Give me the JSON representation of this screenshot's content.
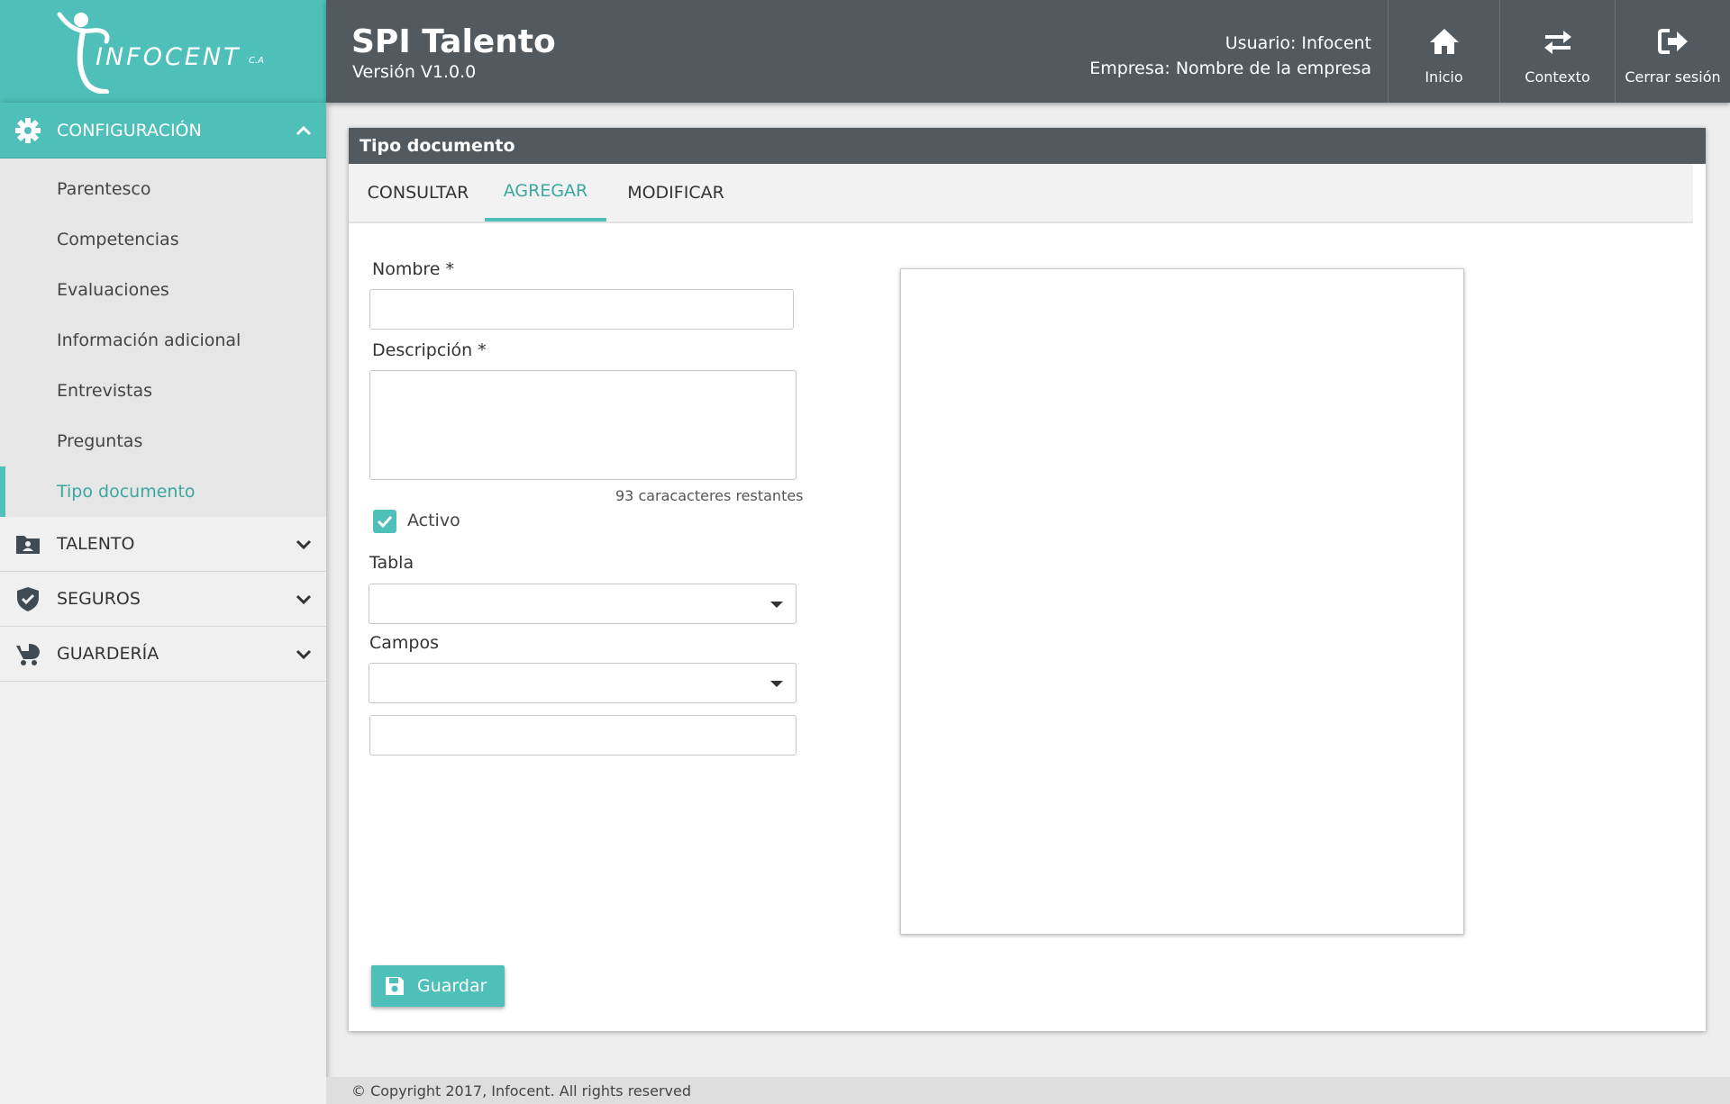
{
  "brand": {
    "logo_text": "INFOCENT",
    "logo_suffix": "C.A"
  },
  "header": {
    "app_title": "SPI Talento",
    "version": "Versión  V1.0.0",
    "user_line": "Usuario: Infocent",
    "company_line": "Empresa: Nombre de la empresa",
    "buttons": [
      {
        "label": "Inicio",
        "icon": "home-icon"
      },
      {
        "label": "Contexto",
        "icon": "swap-arrows-icon"
      },
      {
        "label": "Cerrar sesión",
        "icon": "sign-out-icon"
      }
    ]
  },
  "sidebar": {
    "config": {
      "label": "CONFIGURACIÓN",
      "icon": "gear-icon",
      "items": [
        {
          "label": "Parentesco"
        },
        {
          "label": "Competencias"
        },
        {
          "label": "Evaluaciones"
        },
        {
          "label": "Información adicional"
        },
        {
          "label": "Entrevistas"
        },
        {
          "label": "Preguntas"
        },
        {
          "label": "Tipo documento",
          "active": true
        }
      ]
    },
    "sections": [
      {
        "label": "TALENTO",
        "icon": "id-card-folder-icon"
      },
      {
        "label": "SEGUROS",
        "icon": "shield-icon"
      },
      {
        "label": "GUARDERÍA",
        "icon": "baby-carriage-icon"
      }
    ]
  },
  "panel": {
    "title": "Tipo documento",
    "tabs": [
      {
        "label": "CONSULTAR"
      },
      {
        "label": "AGREGAR",
        "active": true
      },
      {
        "label": "MODIFICAR"
      }
    ],
    "form": {
      "nombre_label": "Nombre *",
      "nombre_value": "",
      "descripcion_label": "Descripción *",
      "descripcion_value": "",
      "counter": "93 caracacteres restantes",
      "activo_label": "Activo",
      "activo_checked": true,
      "tabla_label": "Tabla",
      "tabla_value": "",
      "campos_label": "Campos",
      "campos_value": "",
      "extra_value": ""
    },
    "save_label": "Guardar"
  },
  "footer": {
    "text": "© Copyright 2017, Infocent. All rights reserved"
  },
  "colors": {
    "teal": "#4ec0b9",
    "dark": "#525a60",
    "teal_text": "#3aa89f"
  }
}
